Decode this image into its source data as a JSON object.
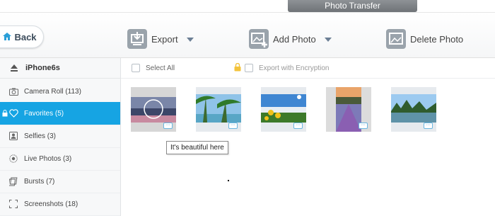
{
  "window": {
    "title": "Photo Transfer"
  },
  "toolbar": {
    "back_label": "Back",
    "export_label": "Export",
    "add_photo_label": "Add Photo",
    "delete_photo_label": "Delete Photo"
  },
  "sidebar": {
    "device": "iPhone6s",
    "items": [
      {
        "label": "Camera Roll (113)",
        "icon": "camera-icon"
      },
      {
        "label": "Favorites (5)",
        "icon": "heart-icon",
        "active": true,
        "locked": true
      },
      {
        "label": "Selfies (3)",
        "icon": "person-icon"
      },
      {
        "label": "Live Photos (3)",
        "icon": "live-photo-icon"
      },
      {
        "label": "Bursts (7)",
        "icon": "bursts-icon"
      },
      {
        "label": "Screenshots (18)",
        "icon": "screenshot-icon"
      }
    ]
  },
  "content": {
    "select_all_label": "Select All",
    "export_encryption_label": "Export with Encryption",
    "tooltip": "It's beautiful here"
  },
  "colors": {
    "accent": "#16a4e3",
    "title_tab": "#7d8185"
  }
}
